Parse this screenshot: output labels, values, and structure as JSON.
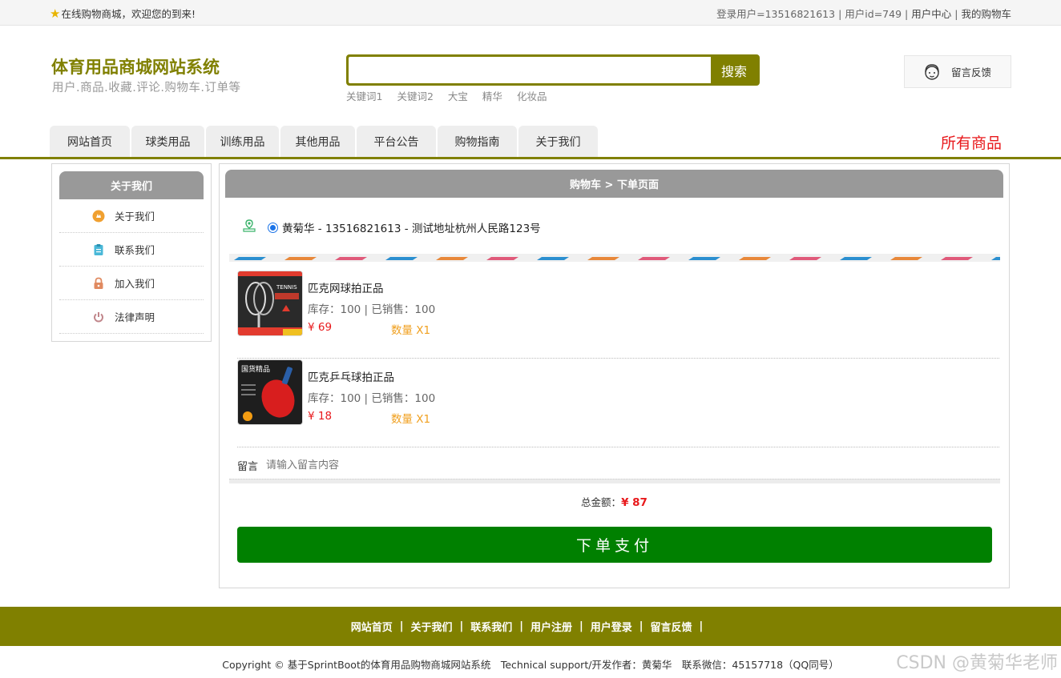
{
  "topbar": {
    "welcome": "在线购物商城，欢迎您的到来!",
    "login_user": "登录用户=13516821613",
    "user_id": "用户id=749",
    "user_center": "用户中心",
    "my_cart": "我的购物车"
  },
  "header": {
    "title": "体育用品商城网站系统",
    "subtitle": "用户.商品.收藏.评论.购物车.订单等",
    "search": {
      "placeholder": "",
      "button": "搜索"
    },
    "hotwords": [
      "关键词1",
      "关键词2",
      "大宝",
      "精华",
      "化妆品"
    ],
    "feedback": "留言反馈"
  },
  "nav": {
    "tabs": [
      "网站首页",
      "球类用品",
      "训练用品",
      "其他用品",
      "平台公告",
      "购物指南",
      "关于我们"
    ],
    "all_goods": "所有商品"
  },
  "sidebar": {
    "title": "关于我们",
    "items": [
      "关于我们",
      "联系我们",
      "加入我们",
      "法律声明"
    ]
  },
  "main": {
    "breadcrumb": "购物车 > 下单页面",
    "address": "黄菊华 - 13516821613 - 测试地址杭州人民路123号",
    "items": [
      {
        "name": "匹克网球拍正品",
        "stock": "库存：100 | 已销售：100",
        "price": "¥ 69",
        "qty": "数量 X1"
      },
      {
        "name": "匹克乒乓球拍正品",
        "stock": "库存：100 | 已销售：100",
        "price": "¥ 18",
        "qty": "数量 X1"
      }
    ],
    "message_label": "留言",
    "message_placeholder": "请输入留言内容",
    "total_label": "总金额：",
    "total_value": "¥ 87",
    "pay_button": "下单支付"
  },
  "footer": {
    "links": [
      "网站首页",
      "关于我们",
      "联系我们",
      "用户注册",
      "用户登录",
      "留言反馈"
    ],
    "copyright": "Copyright © 基于SprintBoot的体育用品购物商城网站系统　Technical support/开发作者：黄菊华　联系微信：45157718（QQ同号）",
    "watermark": "CSDN @黄菊华老师"
  }
}
